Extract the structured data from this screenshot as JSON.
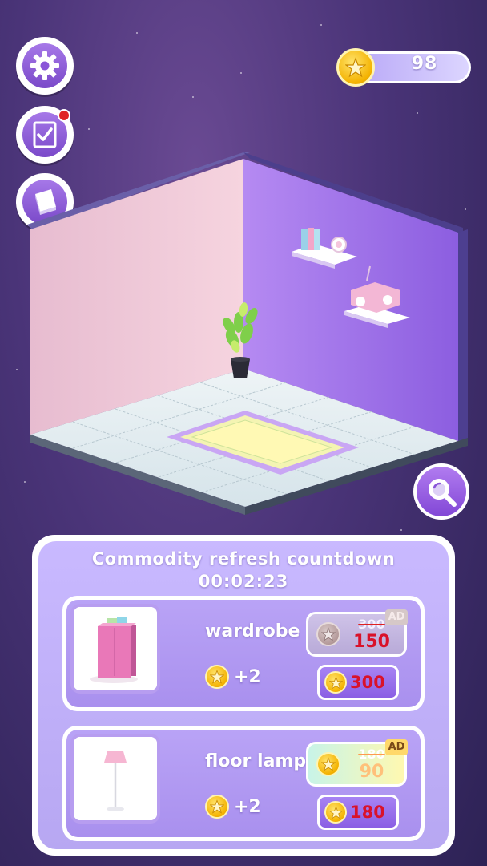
{
  "hud": {
    "coins": "98",
    "settings_icon": "gear-icon",
    "tasks_icon": "checklist-icon",
    "book_icon": "book-icon",
    "zoom_icon": "magnifier-icon"
  },
  "shop": {
    "title": "Commodity refresh countdown",
    "timer": "00:02:23",
    "items": [
      {
        "name": "wardrobe",
        "reward": "+2",
        "ad_tag": "AD",
        "old_price": "300",
        "ad_price": "150",
        "price": "300",
        "ad_enabled": false
      },
      {
        "name": "floor lamp",
        "reward": "+2",
        "ad_tag": "AD",
        "old_price": "180",
        "ad_price": "90",
        "price": "180",
        "ad_enabled": true
      }
    ]
  },
  "colors": {
    "accent": "#8a5fe4",
    "price_red": "#d9122a",
    "coin_gold": "#f4b200"
  }
}
